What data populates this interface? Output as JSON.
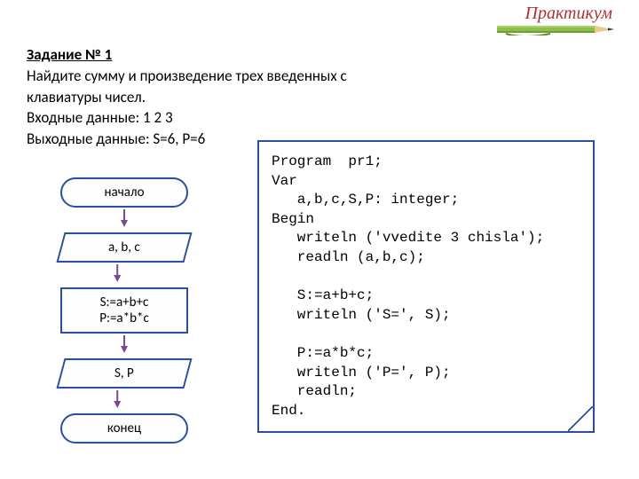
{
  "brand": {
    "word": "Практикум"
  },
  "task": {
    "title": "Задание № 1",
    "line1": "Найдите сумму и произведение трех введенных с",
    "line2": "клавиатуры чисел.",
    "input_label": "Входные данные:  1 2 3",
    "output_label": "Выходные данные: S=6, P=6"
  },
  "flow": {
    "start": "начало",
    "input": "a, b, c",
    "process1": "S:=a+b+c",
    "process2": "P:=a*b*c",
    "output": "S, P",
    "end": "конец"
  },
  "code": {
    "l1": "Program  pr1;",
    "l2": "Var",
    "l3": "   a,b,c,S,P: integer;",
    "l4": "Begin",
    "l5": "   writeln ('vvedite 3 chisla');",
    "l6": "   readln (a,b,c);",
    "l7": "",
    "l8": "   S:=a+b+c;",
    "l9": "   writeln ('S=', S);",
    "l10": "",
    "l11": "   P:=a*b*c;",
    "l12": "   writeln ('P=', P);",
    "l13": "   readln;",
    "l14": "End."
  }
}
